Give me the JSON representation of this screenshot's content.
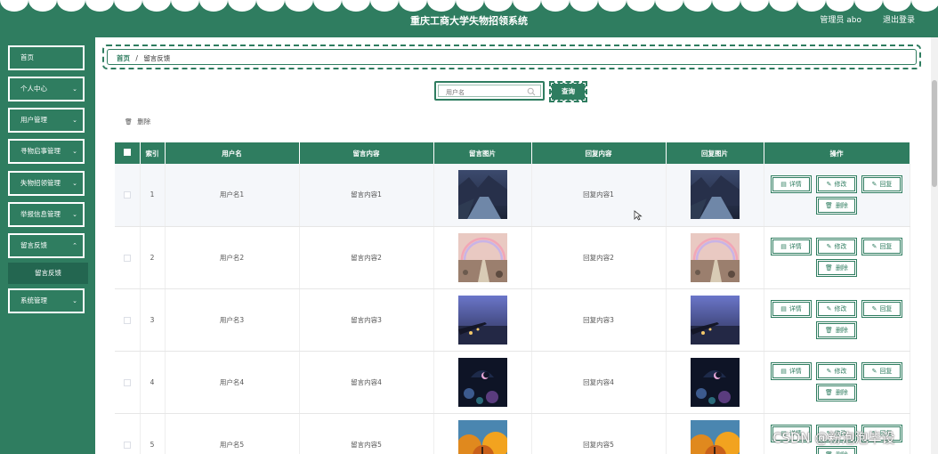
{
  "header": {
    "title": "重庆工商大学失物招领系统",
    "user_label": "管理员 abo",
    "logout_label": "退出登录"
  },
  "sidebar": {
    "items": [
      {
        "label": "首页",
        "has_arrow": false
      },
      {
        "label": "个人中心",
        "has_arrow": true
      },
      {
        "label": "用户管理",
        "has_arrow": true
      },
      {
        "label": "寻物启事管理",
        "has_arrow": true
      },
      {
        "label": "失物招领管理",
        "has_arrow": true
      },
      {
        "label": "举报信息管理",
        "has_arrow": true
      },
      {
        "label": "留言反馈",
        "has_arrow": true
      },
      {
        "label": "系统管理",
        "has_arrow": true
      }
    ],
    "submenu": {
      "label": "留言反馈"
    }
  },
  "breadcrumb": {
    "home": "首页",
    "separator": "/",
    "current": "留言反馈"
  },
  "search": {
    "placeholder": "用户名",
    "button_label": "查询"
  },
  "toolbar": {
    "delete_label": "删除"
  },
  "table": {
    "columns": [
      "",
      "索引",
      "用户名",
      "留言内容",
      "留言图片",
      "回复内容",
      "回复图片",
      "操作"
    ],
    "rows": [
      {
        "index": "1",
        "username": "用户名1",
        "message": "留言内容1",
        "reply": "回复内容1",
        "image": "image-river-dusk"
      },
      {
        "index": "2",
        "username": "用户名2",
        "message": "留言内容2",
        "reply": "回复内容2",
        "image": "image-rainbow-path"
      },
      {
        "index": "3",
        "username": "用户名3",
        "message": "留言内容3",
        "reply": "回复内容3",
        "image": "image-pier-night"
      },
      {
        "index": "4",
        "username": "用户名4",
        "message": "留言内容4",
        "reply": "回复内容4",
        "image": "image-umbrella-moon"
      },
      {
        "index": "5",
        "username": "用户名5",
        "message": "留言内容5",
        "reply": "回复内容5",
        "image": "image-autumn-trees"
      }
    ],
    "actions": {
      "detail": "详情",
      "edit": "修改",
      "reply": "回复",
      "delete": "删除"
    }
  },
  "watermark": "CSDN @粉泡泡毕设",
  "colors": {
    "primary": "#2f7d60",
    "submenu": "#236650",
    "text": "#333333"
  }
}
